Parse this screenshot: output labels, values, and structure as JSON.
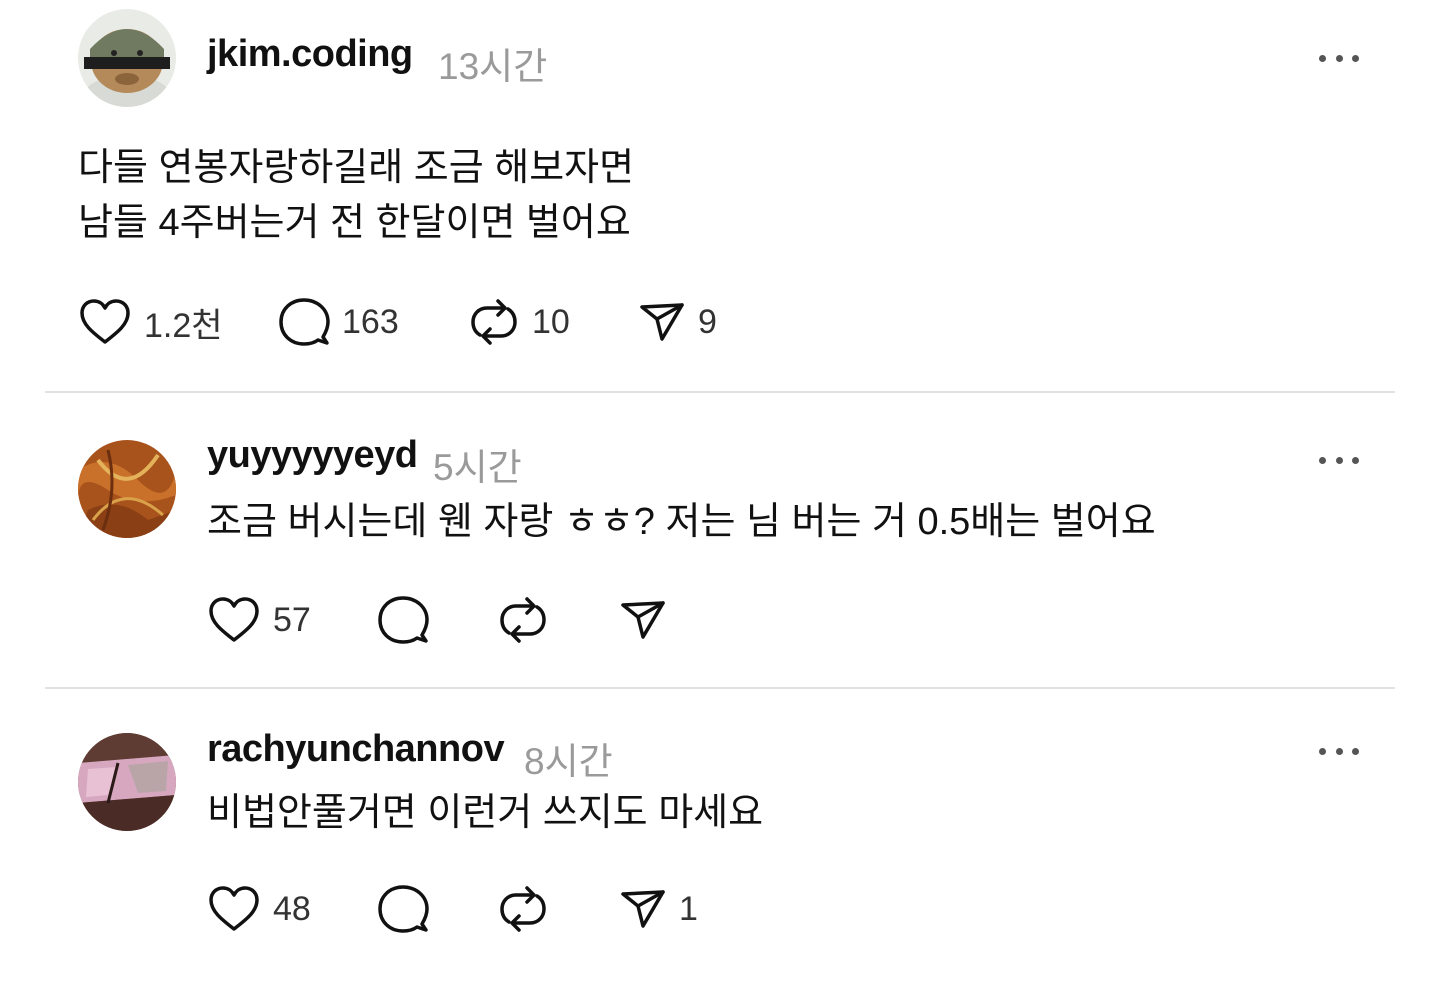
{
  "thread": {
    "main_post": {
      "username": "jkim.coding",
      "time": "13시간",
      "text_lines": [
        "다들 연봉자랑하길래 조금 해보자면",
        "남들 4주버는거 전 한달이면 벌어요"
      ],
      "likes": "1.2천",
      "comments": "163",
      "reposts": "10",
      "shares": "9"
    },
    "replies": [
      {
        "username": "yuyyyyyeyd",
        "time": "5시간",
        "text": "조금 버시는데 웬 자랑 ㅎㅎ? 저는 님 버는 거 0.5배는 벌어요",
        "likes": "57",
        "comments": "",
        "reposts": "",
        "shares": ""
      },
      {
        "username": "rachyunchannov",
        "time": "8시간",
        "text": "비법안풀거면 이런거 쓰지도 마세요",
        "likes": "48",
        "comments": "",
        "reposts": "",
        "shares": "1"
      }
    ]
  },
  "icons": {
    "like": "heart-icon",
    "comment": "comment-bubble-icon",
    "repost": "repost-icon",
    "share": "send-icon",
    "more": "more-options-icon"
  },
  "colors": {
    "text": "#111111",
    "meta": "#9a9a9a",
    "divider": "#e2e2e2"
  }
}
